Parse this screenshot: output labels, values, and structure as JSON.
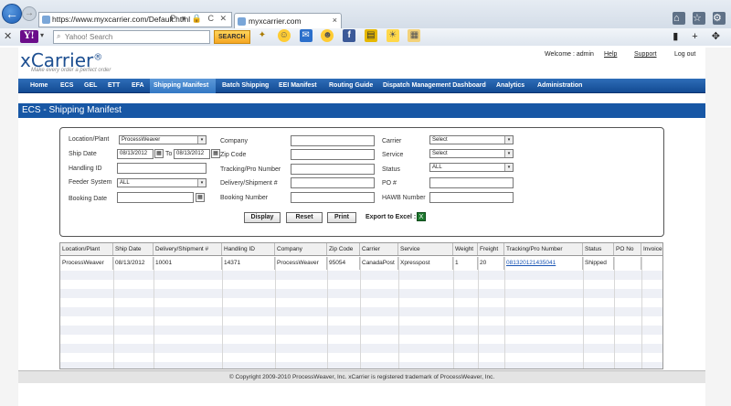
{
  "browser": {
    "url": "https://www.myxcarrier.com/Default.html",
    "tab_title": "myxcarrier.com",
    "tab_close": "×",
    "addr_icons": "P ▾ 🔒 C ✕",
    "win_icons": [
      "⌂",
      "☆",
      "⚙"
    ]
  },
  "toolbar": {
    "yahoo_logo": "Y!",
    "search_placeholder": "Yahoo! Search",
    "search_button": "SEARCH",
    "close": "✕",
    "right_icons": "▮ + ✥"
  },
  "header": {
    "logo": "xCarrier",
    "logo_mark": "®",
    "tagline": "Make every order a perfect order",
    "welcome": "Welcome : admin",
    "help": "Help",
    "support": "Support",
    "logout": "Log out"
  },
  "menu": {
    "items": [
      "Home",
      "ECS",
      "GEL",
      "ETT",
      "EFA",
      "Shipping Manifest",
      "Batch Shipping",
      "EEI Manifest",
      "Routing Guide",
      "Dispatch Management Dashboard",
      "Analytics",
      "Administration"
    ],
    "active": "Shipping Manifest"
  },
  "page_title": "ECS - Shipping Manifest",
  "form": {
    "location_label": "Location/Plant",
    "location_value": "ProcessWeaver",
    "ship_date_label": "Ship Date",
    "ship_date_from": "08/13/2012",
    "to_label": "To",
    "ship_date_to": "08/13/2012",
    "handling_label": "Handling ID",
    "feeder_label": "Feeder System",
    "feeder_value": "ALL",
    "booking_label": "Booking Date",
    "company_label": "Company",
    "zip_label": "Zip Code",
    "tracking_label": "Tracking/Pro Number",
    "delivery_label": "Delivery/Shipment #",
    "booking_number_label": "Booking Number",
    "carrier_label": "Carrier",
    "carrier_value": "Select",
    "service_label": "Service",
    "service_value": "Select",
    "status_label": "Status",
    "status_value": "ALL",
    "po_label": "PO #",
    "hawb_label": "HAWB Number",
    "display_button": "Display",
    "reset_button": "Reset",
    "print_button": "Print",
    "export_label": "Export to Excel :"
  },
  "table": {
    "headers": [
      "Location/Plant",
      "Ship Date",
      "Delivery/Shipment #",
      "Handling ID",
      "Company",
      "Zip Code",
      "Carrier",
      "Service",
      "Weight",
      "Freight",
      "Tracking/Pro Number",
      "Status",
      "PO No",
      "Invoice"
    ],
    "rows": [
      [
        "ProcessWeaver",
        "08/13/2012",
        "10001",
        "14371",
        "ProcessWeaver",
        "95054",
        "CanadaPost",
        "Xpresspost",
        "1",
        "20",
        "081320121435041",
        "Shipped",
        "",
        ""
      ]
    ]
  },
  "footer": "© Copyright 2009-2010 ProcessWeaver, Inc. xCarrier is registered trademark of ProcessWeaver, Inc."
}
